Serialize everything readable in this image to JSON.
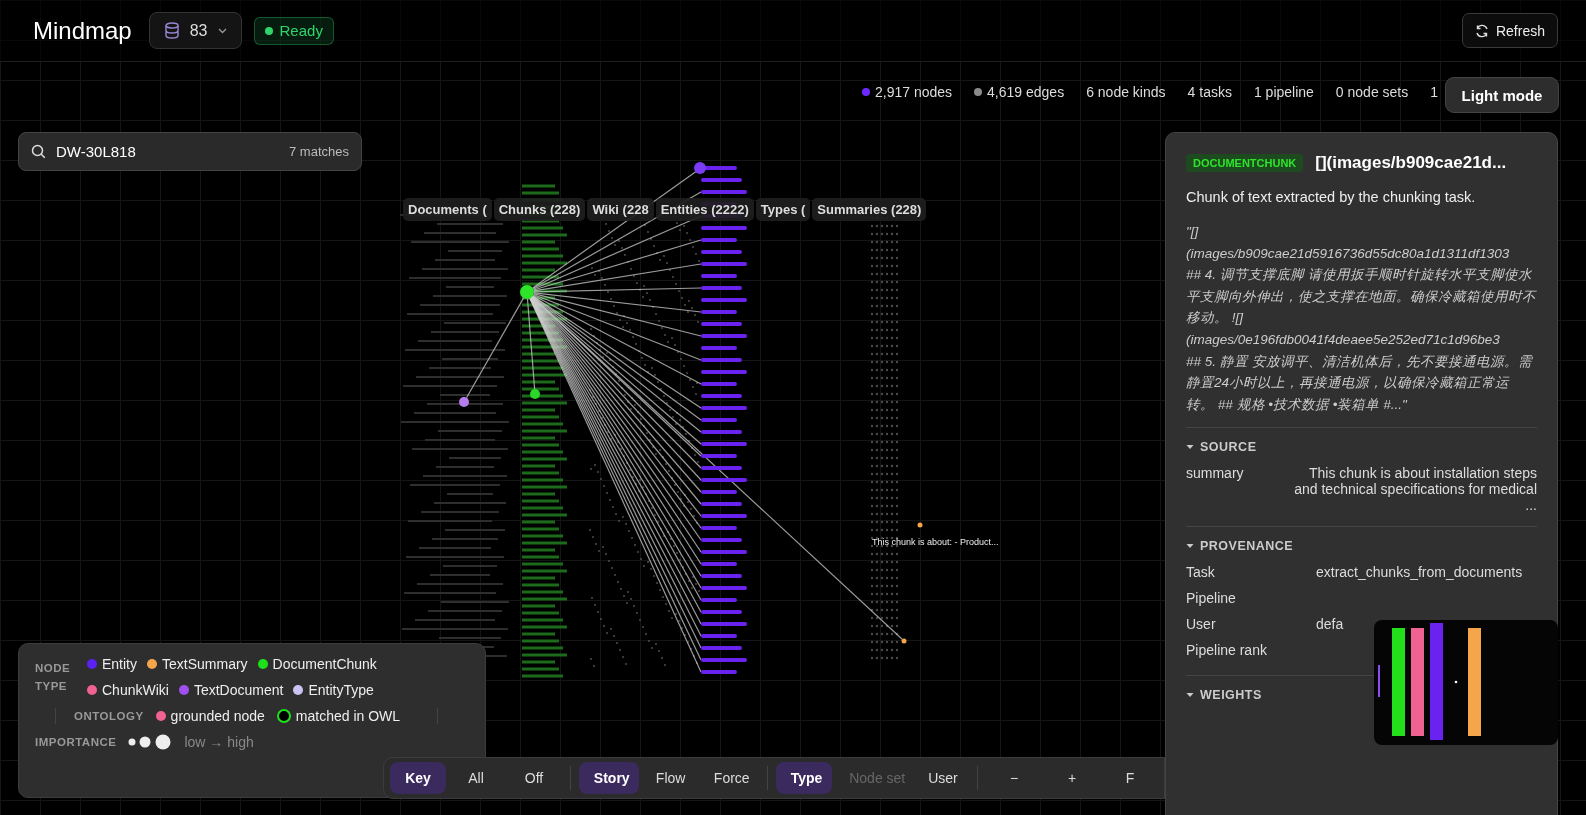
{
  "app_title": "Mindmap",
  "dataset": {
    "label": "83"
  },
  "status": {
    "label": "Ready",
    "kind": "ready"
  },
  "refresh": "Refresh",
  "stats": [
    {
      "label": "2,917 nodes",
      "color": "#6d28ff"
    },
    {
      "label": "4,619 edges",
      "color": "#8a8a8a"
    },
    {
      "label": "6 node kinds"
    },
    {
      "label": "4 tasks"
    },
    {
      "label": "1 pipeline"
    },
    {
      "label": "0 node sets"
    },
    {
      "label": "1"
    }
  ],
  "theme_button": "Light mode",
  "search": {
    "value": "DW-30L818",
    "matches": "7 matches"
  },
  "graph": {
    "columns": [
      {
        "label": "Documents ("
      },
      {
        "label": "Chunks (228)"
      },
      {
        "label": "Wiki (228"
      },
      {
        "label": "Entities (2222)"
      },
      {
        "label": "Types ("
      },
      {
        "label": "Summaries (228)"
      }
    ],
    "node_label": "This chunk is about: - Product..."
  },
  "details": {
    "type_badge": "DOCUMENTCHUNK",
    "title": "[](images/b909cae21d...",
    "description": "Chunk of text extracted by the chunking task.",
    "content": "\"[]\n(images/b909cae21d5916736d55dc80a1d1311df1303\n## 4. 调节支撑底脚 请使用扳手顺时针旋转水平支脚使水平支脚向外伸出，使之支撑在地面。确保冷藏箱使用时不移动。 ![]\n(images/0e196fdb0041f4deaee5e252ed71c1d96be3\n## 5. 静置 安放调平、清洁机体后，先不要接通电源。需静置24小时以上，再接通电源，以确保冷藏箱正常运转。 ## 规格 •技术数据 •装箱单 #...\"",
    "sections": [
      {
        "title": "SOURCE",
        "expanded": true,
        "rows": [
          {
            "key": "summary",
            "value": "This chunk is about installation steps and technical specifications for medical ..."
          }
        ]
      },
      {
        "title": "PROVENANCE",
        "expanded": true,
        "rows": [
          {
            "key": "Task",
            "value": "extract_chunks_from_documents"
          },
          {
            "key": "Pipeline"
          },
          {
            "key": "User",
            "value": "defa"
          },
          {
            "key": "Pipeline rank"
          }
        ]
      },
      {
        "title": "WEIGHTS",
        "expanded": true
      }
    ]
  },
  "legend": {
    "node_type_title": "NODE TYPE",
    "node_types": [
      {
        "label": "Entity",
        "color": "#5b21f5"
      },
      {
        "label": "TextSummary",
        "color": "#f5a54a"
      },
      {
        "label": "DocumentChunk",
        "color": "#1ee01a"
      },
      {
        "label": "ChunkWiki",
        "color": "#f06292"
      },
      {
        "label": "TextDocument",
        "color": "#a24ff0"
      },
      {
        "label": "EntityType",
        "color": "#cbc4f3"
      }
    ],
    "ontology_title": "ONTOLOGY",
    "ontology": [
      {
        "label": "grounded node",
        "kind": "dot",
        "color": "#f06292"
      },
      {
        "label": "matched in OWL",
        "kind": "ring",
        "color": "#1ee01a"
      }
    ],
    "importance_title": "IMPORTANCE",
    "importance_label": "low → high"
  },
  "toolbar": {
    "groups": [
      {
        "items": [
          {
            "label": "Key",
            "selected": true
          },
          {
            "label": "All",
            "selected": false
          },
          {
            "label": "Off",
            "selected": false
          }
        ]
      },
      {
        "items": [
          {
            "label": "Story",
            "selected": true
          },
          {
            "label": "Flow",
            "selected": false
          },
          {
            "label": "Force",
            "selected": false
          }
        ]
      },
      {
        "items": [
          {
            "label": "Type",
            "selected": true
          },
          {
            "label": "Node set",
            "selected": false,
            "disabled": true
          },
          {
            "label": "User",
            "selected": false
          }
        ]
      },
      {
        "items": [
          {
            "label": "−",
            "selected": false
          },
          {
            "label": "+",
            "selected": false
          },
          {
            "label": "F",
            "selected": false
          }
        ]
      }
    ]
  }
}
